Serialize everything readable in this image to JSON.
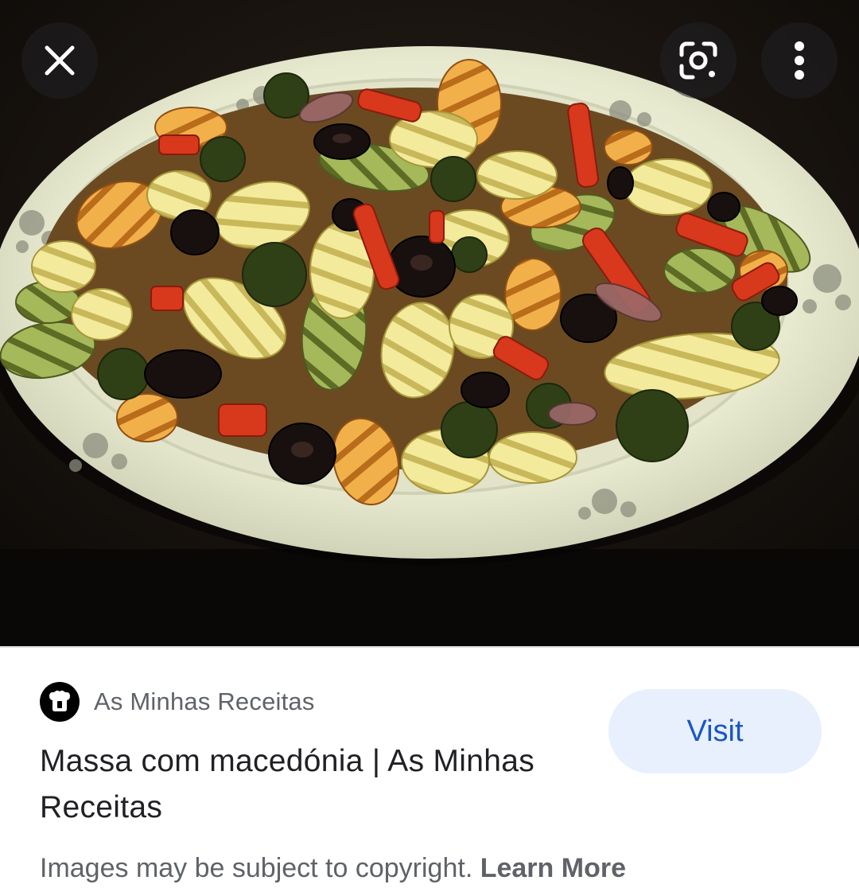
{
  "viewer": {
    "close_icon": "close-icon",
    "lens_icon": "google-lens-icon",
    "more_icon": "more-vert-icon"
  },
  "result": {
    "source_name": "As Minhas Receitas",
    "favicon_icon": "site-favicon",
    "title": "Massa com macedónia | As Minhas Receitas",
    "visit_label": "Visit"
  },
  "footer": {
    "copyright_text": "Images may be subject to copyright.",
    "learn_more_label": "Learn More"
  },
  "colors": {
    "visit_bg": "#e8f0fe",
    "visit_text": "#1a56c4",
    "secondary_text": "#5f6368",
    "primary_text": "#202124"
  }
}
